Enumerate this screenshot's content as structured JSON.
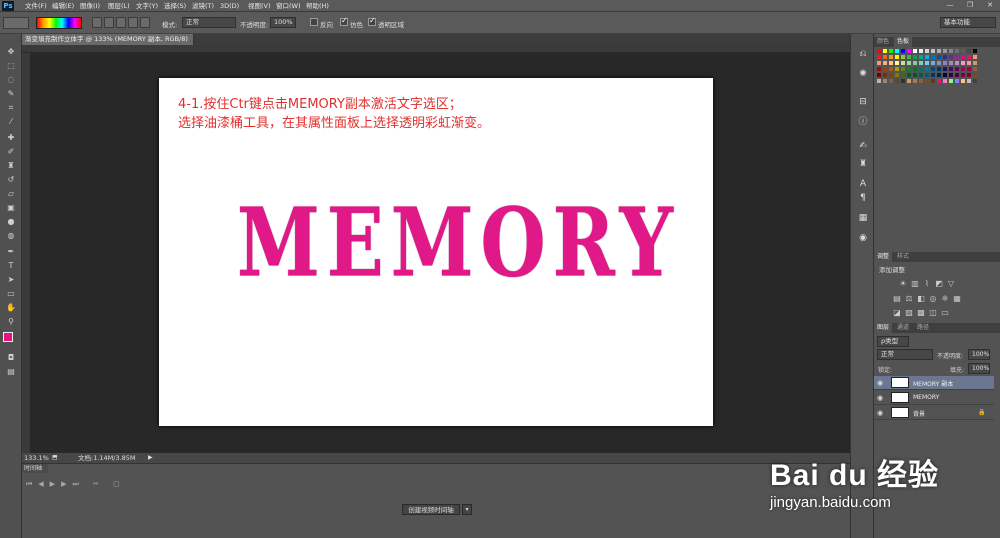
{
  "app": {
    "logo": "Ps"
  },
  "menu": [
    "文件(F)",
    "编辑(E)",
    "图像(I)",
    "图层(L)",
    "文字(Y)",
    "选择(S)",
    "滤镜(T)",
    "3D(D)",
    "视图(V)",
    "窗口(W)",
    "帮助(H)"
  ],
  "window_controls": [
    "—",
    "❐",
    "✕"
  ],
  "options": {
    "mode_label": "模式:",
    "mode_value": "正常",
    "opacity_label": "不透明度:",
    "opacity_value": "100%",
    "reverse_label": "反向",
    "dither_label": "仿色",
    "transparency_label": "透明区域",
    "workspace": "基本功能"
  },
  "document": {
    "tab_title": "渐变填充制作立体字 @ 133% (MEMORY 副本, RGB/8) *",
    "close": "×",
    "annotation_line1": "4-1.按住Ctr键点击MEMORY副本激活文字选区；",
    "annotation_line2": "选择油漆桶工具，在其属性面板上选择透明彩虹渐变。",
    "text_layer_content": "MEMORY"
  },
  "status": {
    "zoom": "133.1%",
    "doc_info": "文档:1.14M/3.85M"
  },
  "timeline": {
    "tab": "时间轴",
    "create_button": "创建视频时间轴"
  },
  "panels": {
    "top_tabs": [
      "颜色",
      "色板"
    ],
    "adjust_tabs": [
      "调整",
      "样式"
    ],
    "add_adjustment": "添加调整",
    "layer_tabs": [
      "图层",
      "通道",
      "路径"
    ],
    "kind_label": "ρ类型",
    "blend_mode": "正常",
    "opacity_label": "不透明度:",
    "opacity_value": "100%",
    "lock_label": "锁定:",
    "fill_label": "填充:",
    "fill_value": "100%"
  },
  "layers": [
    {
      "name": "MEMORY 副本",
      "active": true
    },
    {
      "name": "MEMORY",
      "active": false
    },
    {
      "name": "背景",
      "active": false
    }
  ],
  "colors": {
    "foreground": "#e0157f",
    "background": "#000000",
    "text_magenta": "#e01888",
    "annotation_red": "#e0302e"
  },
  "watermark": {
    "logo": "Bai du 经验",
    "url": "jingyan.baidu.com"
  }
}
